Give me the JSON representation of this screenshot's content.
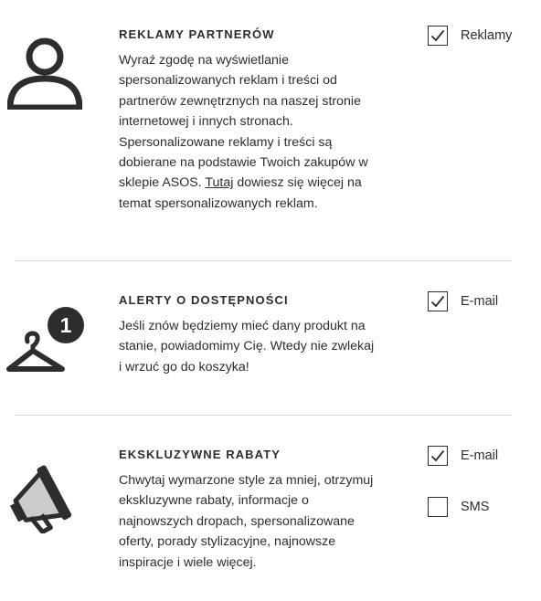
{
  "sections": [
    {
      "title": "REKLAMY PARTNERÓW",
      "icon": "person-icon",
      "description_before_link": "Wyraź zgodę na wyświetlanie spersonalizowanych reklam i treści od partnerów zewnętrznych na naszej stronie internetowej i innych stronach. Spersonalizowane reklamy i treści są dobierane na podstawie Twoich zakupów w sklepie ASOS.",
      "link_text": "Tutaj",
      "description_after_link": "dowiesz się więcej na temat spersonalizowanych reklam.",
      "options": [
        {
          "label": "Reklamy",
          "checked": true
        }
      ]
    },
    {
      "title": "ALERTY O DOSTĘPNOŚCI",
      "icon": "hanger-notification-icon",
      "badge": "1",
      "description": "Jeśli znów będziemy mieć dany produkt na stanie, powiadomimy Cię. Wtedy nie zwlekaj i wrzuć go do koszyka!",
      "options": [
        {
          "label": "E-mail",
          "checked": true
        }
      ]
    },
    {
      "title": "EKSKLUZYWNE RABATY",
      "icon": "megaphone-icon",
      "description": "Chwytaj wymarzone style za mniej, otrzymuj ekskluzywne rabaty, informacje o najnowszych dropach, spersonalizowane oferty, porady stylizacyjne, najnowsze inspiracje i wiele więcej.",
      "options": [
        {
          "label": "E-mail",
          "checked": true
        },
        {
          "label": "SMS",
          "checked": false
        }
      ]
    }
  ]
}
